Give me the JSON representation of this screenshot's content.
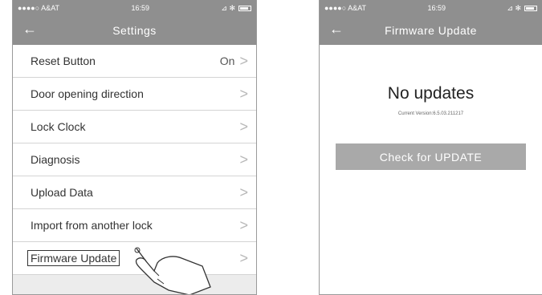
{
  "left": {
    "status": {
      "carrier": "●●●●○ A&AT",
      "time": "16:59",
      "icons": "⊿ ✻"
    },
    "nav": {
      "title": "Settings",
      "back": "←"
    },
    "rows": [
      {
        "label": "Reset Button",
        "value": "On"
      },
      {
        "label": "Door opening direction",
        "value": ""
      },
      {
        "label": "Lock Clock",
        "value": ""
      },
      {
        "label": "Diagnosis",
        "value": ""
      },
      {
        "label": "Upload Data",
        "value": ""
      },
      {
        "label": "Import from another lock",
        "value": ""
      },
      {
        "label": "Firmware Update",
        "value": ""
      }
    ],
    "chevron": ">"
  },
  "right": {
    "status": {
      "carrier": "●●●●○ A&AT",
      "time": "16:59",
      "icons": "⊿ ✻"
    },
    "nav": {
      "title": "Firmware Update",
      "back": "←"
    },
    "heading": "No updates",
    "version": "Current Version:6.5.03.211217",
    "button": "Check for UPDATE"
  },
  "colors": {
    "bar": "#8f8f8f",
    "button": "#a9a9a9"
  }
}
